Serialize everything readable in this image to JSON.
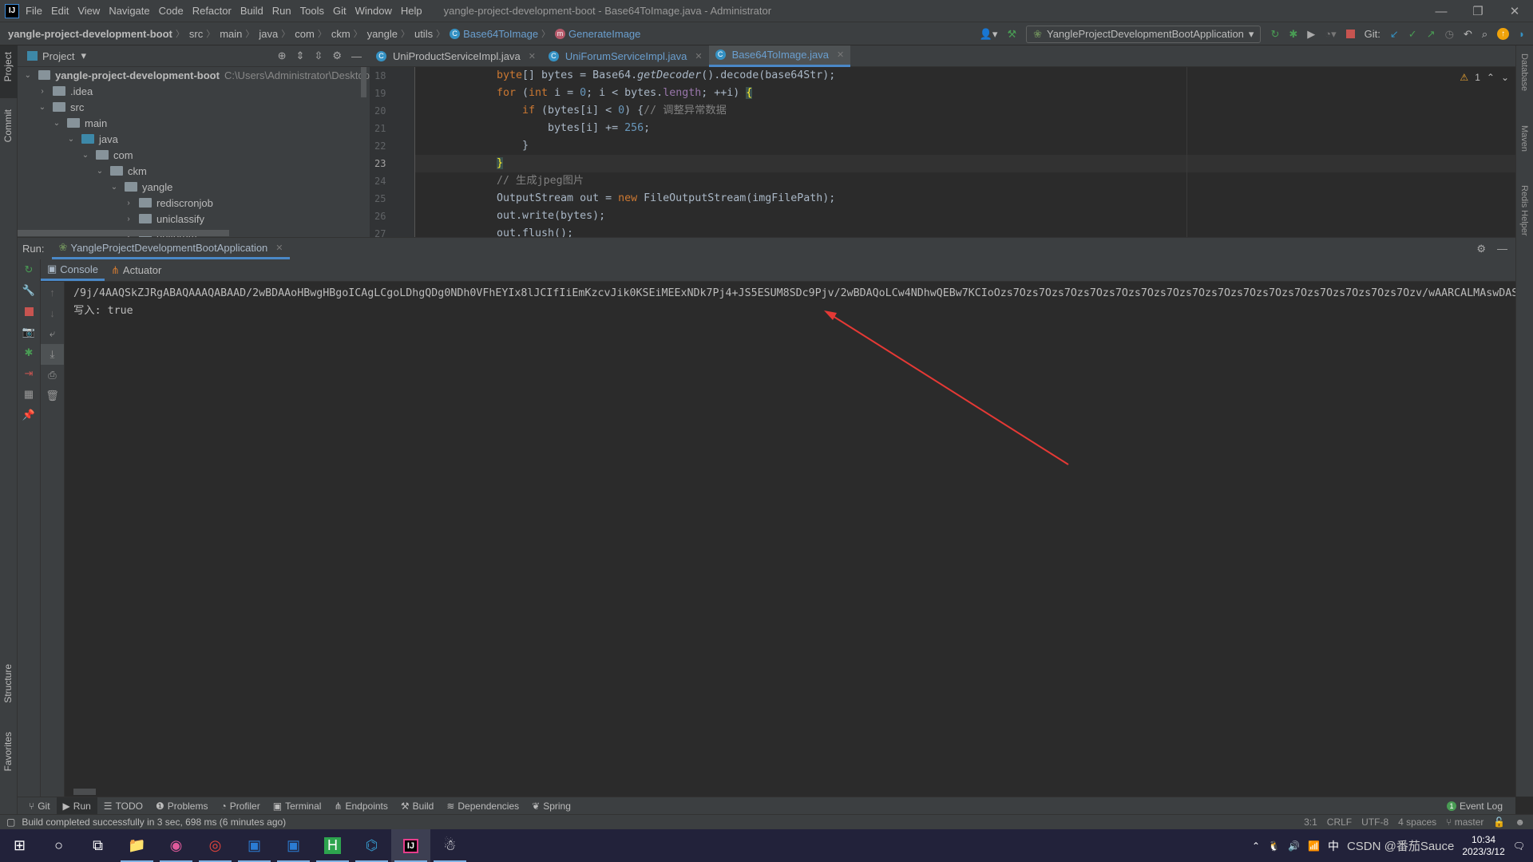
{
  "window": {
    "title": "yangle-project-development-boot - Base64ToImage.java - Administrator",
    "menu": [
      "File",
      "Edit",
      "View",
      "Navigate",
      "Code",
      "Refactor",
      "Build",
      "Run",
      "Tools",
      "Git",
      "Window",
      "Help"
    ],
    "controls": {
      "minimize": "—",
      "restore": "❐",
      "close": "✕"
    }
  },
  "breadcrumb": {
    "project": "yangle-project-development-boot",
    "items": [
      "src",
      "main",
      "java",
      "com",
      "ckm",
      "yangle",
      "utils"
    ],
    "class": "Base64ToImage",
    "method": "GenerateImage"
  },
  "toolbar": {
    "run_config": "YangleProjectDevelopmentBootApplication",
    "git_label": "Git:"
  },
  "project_panel": {
    "title": "Project",
    "root": "yangle-project-development-boot",
    "root_path": "C:\\Users\\Administrator\\Desktop",
    "nodes": [
      {
        "label": ".idea",
        "expanded": false
      },
      {
        "label": "src",
        "expanded": true
      },
      {
        "label": "main",
        "expanded": true
      },
      {
        "label": "java",
        "expanded": true
      },
      {
        "label": "com",
        "expanded": true
      },
      {
        "label": "ckm",
        "expanded": true
      },
      {
        "label": "yangle",
        "expanded": true
      },
      {
        "label": "rediscronjob",
        "expanded": false
      },
      {
        "label": "uniclassify",
        "expanded": false
      },
      {
        "label": "uniforum",
        "expanded": true
      }
    ]
  },
  "editor_tabs": [
    {
      "label": "UniProductServiceImpl.java"
    },
    {
      "label": "UniForumServiceImpl.java"
    },
    {
      "label": "Base64ToImage.java",
      "active": true
    }
  ],
  "editor": {
    "line_numbers": [
      "18",
      "19",
      "20",
      "21",
      "22",
      "23",
      "24",
      "25",
      "26",
      "27"
    ],
    "current_line": "23",
    "warning_count": "1",
    "code": {
      "l18": [
        "byte",
        "[] bytes = Base64.",
        "getDecoder",
        "().decode(base64Str);"
      ],
      "l19": [
        "for",
        " (",
        "int",
        " i = ",
        "0",
        "; i < bytes.",
        "length",
        "; ++i) ",
        "{"
      ],
      "l20": [
        "    ",
        "if",
        " (bytes[i] < ",
        "0",
        ") {",
        "// 调整异常数据"
      ],
      "l21": [
        "        bytes[i] += ",
        "256",
        ";"
      ],
      "l22": "    }",
      "l23": "}",
      "l24": "// 生成jpeg图片",
      "l25": [
        "OutputStream out = ",
        "new",
        " FileOutputStream(imgFilePath);"
      ],
      "l26": "out.write(bytes);",
      "l27": "out.flush();"
    }
  },
  "run_panel": {
    "label": "Run:",
    "tab": "YangleProjectDevelopmentBootApplication",
    "subtabs": [
      "Console",
      "Actuator"
    ],
    "output": [
      "/9j/4AAQSkZJRgABAQAAAQABAAD/2wBDAAoHBwgHBgoICAgLCgoLDhgQDg0NDh0VFhEYIx8lJCIfIiEmKzcvJik0KSEiMEExNDk7Pj4+JS5ESUM8SDc9Pjv/2wBDAQoLCw4NDhwQEBw7KCIoOzs7Ozs7Ozs7Ozs7Ozs7Ozs7Ozs7Ozs7Ozs7Ozs7Ozs7Ozs7Ozs7Ozs7Ozs7Ozs7Ozv/wAARCALMAswDAS",
      "写入: true"
    ]
  },
  "bottom_tools": [
    "Git",
    "Run",
    "TODO",
    "Problems",
    "Profiler",
    "Terminal",
    "Endpoints",
    "Build",
    "Dependencies",
    "Spring"
  ],
  "event_log": {
    "label": "Event Log",
    "count": "1"
  },
  "status": {
    "message": "Build completed successfully in 3 sec, 698 ms (6 minutes ago)",
    "position": "3:1",
    "line_ending": "CRLF",
    "encoding": "UTF-8",
    "indent": "4 spaces",
    "branch": "master"
  },
  "side_tabs": {
    "left": [
      "Project",
      "Commit",
      "Structure",
      "Favorites"
    ],
    "right": [
      "Database",
      "Maven",
      "Redis Helper"
    ]
  },
  "taskbar": {
    "time": "10:34",
    "date": "2023/3/12",
    "ime": "中",
    "watermark": "CSDN @番茄Sauce"
  },
  "colors": {
    "accent": "#4a88c7",
    "keyword": "#cc7832",
    "number": "#6897bb",
    "comment": "#808080",
    "annotation_arrow": "#e53935"
  }
}
